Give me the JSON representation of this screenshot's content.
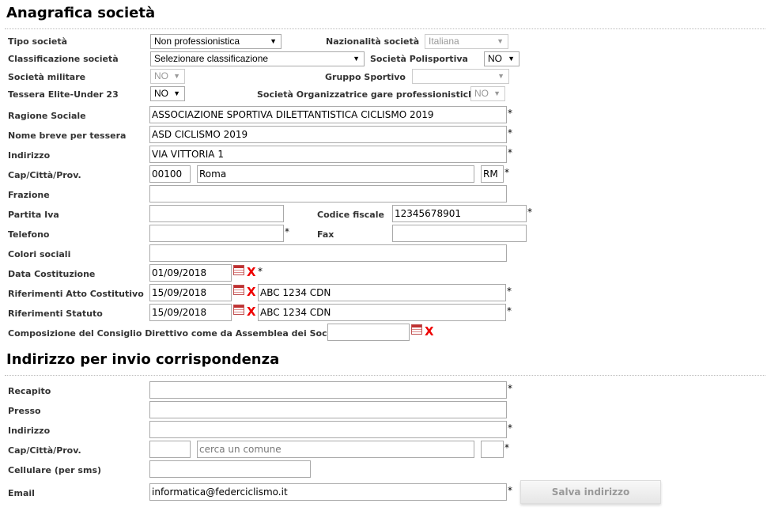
{
  "section1": {
    "title": "Anagrafica società",
    "tipo_label": "Tipo società",
    "tipo_value": "Non professionistica",
    "nazionalita_label": "Nazionalità società",
    "nazionalita_value": "Italiana",
    "classificazione_label": "Classificazione società",
    "classificazione_value": "Selezionare classificazione",
    "polisportiva_label": "Società Polisportiva",
    "polisportiva_value": "NO",
    "militare_label": "Società militare",
    "militare_value": "NO",
    "gruppo_label": "Gruppo Sportivo",
    "gruppo_value": "",
    "elite_label": "Tessera Elite-Under 23",
    "elite_value": "NO",
    "organizzatrice_label": "Società Organizzatrice gare professionistiche",
    "organizzatrice_value": "NO",
    "ragione_label": "Ragione Sociale",
    "ragione_value": "ASSOCIAZIONE SPORTIVA DILETTANTISTICA CICLISMO 2019",
    "nome_breve_label": "Nome breve per tessera",
    "nome_breve_value": "ASD CICLISMO 2019",
    "indirizzo_label": "Indirizzo",
    "indirizzo_value": "VIA VITTORIA 1",
    "cap_label": "Cap/Città/Prov.",
    "cap_value": "00100",
    "citta_value": "Roma",
    "prov_value": "RM",
    "frazione_label": "Frazione",
    "frazione_value": "",
    "piva_label": "Partita Iva",
    "piva_value": "",
    "cf_label": "Codice fiscale",
    "cf_value": "12345678901",
    "telefono_label": "Telefono",
    "telefono_value": "",
    "fax_label": "Fax",
    "fax_value": "",
    "colori_label": "Colori sociali",
    "colori_value": "",
    "costituzione_label": "Data Costituzione",
    "costituzione_value": "01/09/2018",
    "atto_label": "Riferimenti Atto Costitutivo",
    "atto_date": "15/09/2018",
    "atto_ref": "ABC 1234 CDN",
    "statuto_label": "Riferimenti Statuto",
    "statuto_date": "15/09/2018",
    "statuto_ref": "ABC 1234 CDN",
    "consiglio_label": "Composizione del Consiglio Direttivo come da Assemblea dei Soci del:",
    "consiglio_value": ""
  },
  "section2": {
    "title": "Indirizzo per invio corrispondenza",
    "recapito_label": "Recapito",
    "recapito_value": "",
    "presso_label": "Presso",
    "presso_value": "",
    "indirizzo_label": "Indirizzo",
    "indirizzo_value": "",
    "cap_label": "Cap/Città/Prov.",
    "cap_value": "",
    "citta_placeholder": "cerca un comune",
    "prov_value": "",
    "cellulare_label": "Cellulare (per sms)",
    "cellulare_value": "",
    "email_label": "Email",
    "email_value": "informatica@federciclismo.it",
    "save_button": "Salva indirizzo"
  },
  "common": {
    "required_mark": "*",
    "clear_mark": "X",
    "dropdown_arrow": "▼"
  },
  "colors": {
    "clear_mark": "#e00000",
    "disabled_text": "#999999"
  }
}
